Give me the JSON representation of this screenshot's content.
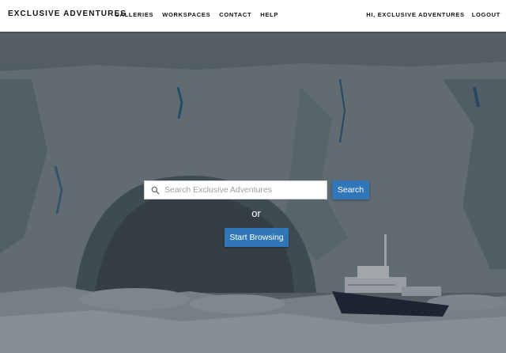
{
  "header": {
    "brand": "EXCLUSIVE ADVENTURES",
    "nav": [
      "GALLERIES",
      "WORKSPACES",
      "CONTACT",
      "HELP"
    ],
    "greeting": "HI, EXCLUSIVE ADVENTURES",
    "logout": "LOGOUT"
  },
  "hero": {
    "search_placeholder": "Search Exclusive Adventures",
    "search_value": "",
    "search_button": "Search",
    "or_text": "or",
    "browse_button": "Start Browsing"
  },
  "colors": {
    "accent": "#2f77b6",
    "header_bg": "#ffffff",
    "ice_overlay": "#5b6870"
  },
  "icons": {
    "search": "search-icon"
  }
}
